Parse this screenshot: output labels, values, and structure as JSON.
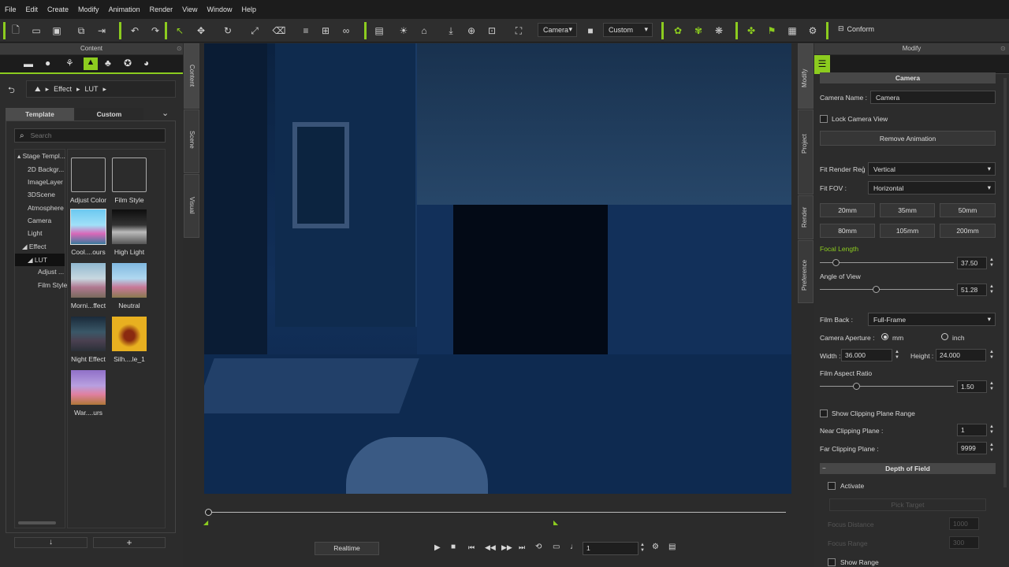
{
  "menu": [
    "File",
    "Edit",
    "Create",
    "Modify",
    "Animation",
    "Render",
    "View",
    "Window",
    "Help"
  ],
  "toolbar": {
    "camera_select": "Camera",
    "view_select": "Custom",
    "conform_label": "Conform"
  },
  "content_panel": {
    "title": "Content",
    "breadcrumb": [
      "Effect",
      "LUT"
    ],
    "tabs": [
      "Template",
      "Custom"
    ],
    "search_placeholder": "Search",
    "tree": [
      {
        "label": "Stage Templ...",
        "level": 0,
        "marker": "▴"
      },
      {
        "label": "2D Backgr...",
        "level": 1
      },
      {
        "label": "ImageLayer",
        "level": 1
      },
      {
        "label": "3DScene",
        "level": 1
      },
      {
        "label": "Atmosphere",
        "level": 1
      },
      {
        "label": "Camera",
        "level": 1
      },
      {
        "label": "Light",
        "level": 1
      },
      {
        "label": "Effect",
        "level": 1,
        "marker": "◢"
      },
      {
        "label": "LUT",
        "level": 2,
        "marker": "◢"
      },
      {
        "label": "Adjust ...",
        "level": 3
      },
      {
        "label": "Film Style",
        "level": 3
      }
    ],
    "items": [
      "Adjust Color",
      "Film Style",
      "Cool....ours",
      "High Light",
      "Morni...ffect",
      "Neutral",
      "Night Effect",
      "Silh....le_1",
      "War....urs"
    ]
  },
  "side_tabs_left": [
    "Content",
    "Scene",
    "Visual"
  ],
  "side_tabs_right": [
    "Modify",
    "Project",
    "Render",
    "Preference"
  ],
  "timeline": {
    "realtime_label": "Realtime",
    "frame_value": "1"
  },
  "modify": {
    "title": "Modify",
    "camera_section": "Camera",
    "camera_name_label": "Camera Name :",
    "camera_name_value": "Camera",
    "lock_camera_label": "Lock Camera View",
    "remove_animation_label": "Remove Animation",
    "fit_render_label": "Fit Render Reģ",
    "fit_render_value": "Vertical",
    "fit_fov_label": "Fit FOV :",
    "fit_fov_value": "Horizontal",
    "lens_buttons": [
      "20mm",
      "35mm",
      "50mm",
      "80mm",
      "105mm",
      "200mm"
    ],
    "focal_length_label": "Focal Length",
    "focal_length_value": "37.50",
    "focal_length_fraction": 0.12,
    "angle_of_view_label": "Angle of View",
    "angle_of_view_value": "51.28",
    "angle_of_view_fraction": 0.42,
    "film_back_label": "Film Back :",
    "film_back_value": "Full-Frame",
    "aperture_label": "Camera Aperture :",
    "aperture_mm": "mm",
    "aperture_inch": "inch",
    "width_label": "Width :",
    "width_value": "36.000",
    "height_label": "Height :",
    "height_value": "24.000",
    "film_aspect_label": "Film Aspect Ratio",
    "film_aspect_value": "1.50",
    "film_aspect_fraction": 0.27,
    "show_clipping_label": "Show Clipping Plane Range",
    "near_clip_label": "Near Clipping Plane :",
    "near_clip_value": "1",
    "far_clip_label": "Far Clipping Plane :",
    "far_clip_value": "9999",
    "dof_section": "Depth of Field",
    "activate_label": "Activate",
    "pick_target_label": "Pick Target",
    "focus_distance_label": "Focus Distance",
    "focus_distance_value": "1000",
    "focus_range_label": "Focus Range",
    "focus_range_value": "300",
    "show_range_label": "Show Range"
  },
  "colors": {
    "accent": "#8ccc1f",
    "viewport": "#0d2a52"
  }
}
